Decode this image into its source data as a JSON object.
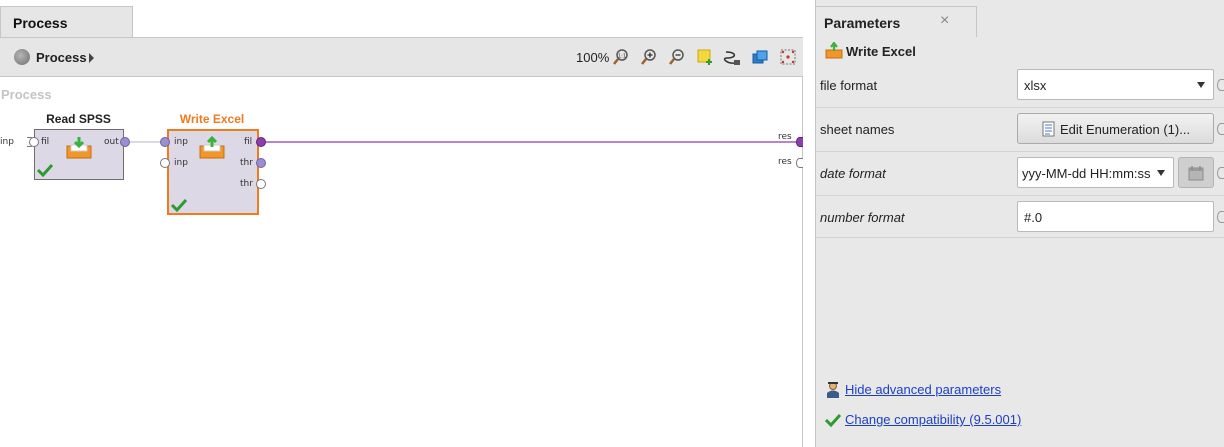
{
  "process_tab": {
    "label": "Process"
  },
  "toolbar": {
    "breadcrumb": "Process",
    "zoom": "100%"
  },
  "canvas": {
    "label": "Process"
  },
  "operators": {
    "read_spss": {
      "title": "Read SPSS",
      "ports_in": [
        "fil"
      ],
      "ports_out": [
        "out"
      ]
    },
    "write_excel": {
      "title": "Write Excel",
      "ports_in": [
        "inp",
        "inp"
      ],
      "ports_out": [
        "fil",
        "thr",
        "thr"
      ]
    }
  },
  "process_ports": {
    "left_inp": "inp",
    "right_res1": "res",
    "right_res2": "res"
  },
  "parameters_panel": {
    "tab_label": "Parameters",
    "close_icon": "×",
    "operator_title": "Write Excel",
    "rows": [
      {
        "label": "file format",
        "value": "xlsx"
      },
      {
        "label": "sheet names",
        "value": "Edit Enumeration (1)..."
      },
      {
        "label": "date format",
        "value": "yyy-MM-dd HH:mm:ss"
      },
      {
        "label": "number format",
        "value": "#.0"
      }
    ],
    "hide_advanced": "Hide advanced parameters",
    "change_compat": "Change compatibility (9.5.001)"
  },
  "colors": {
    "selected_border": "#f07a1e",
    "link": "#1c3fc4",
    "connection": "#8b3fae"
  }
}
